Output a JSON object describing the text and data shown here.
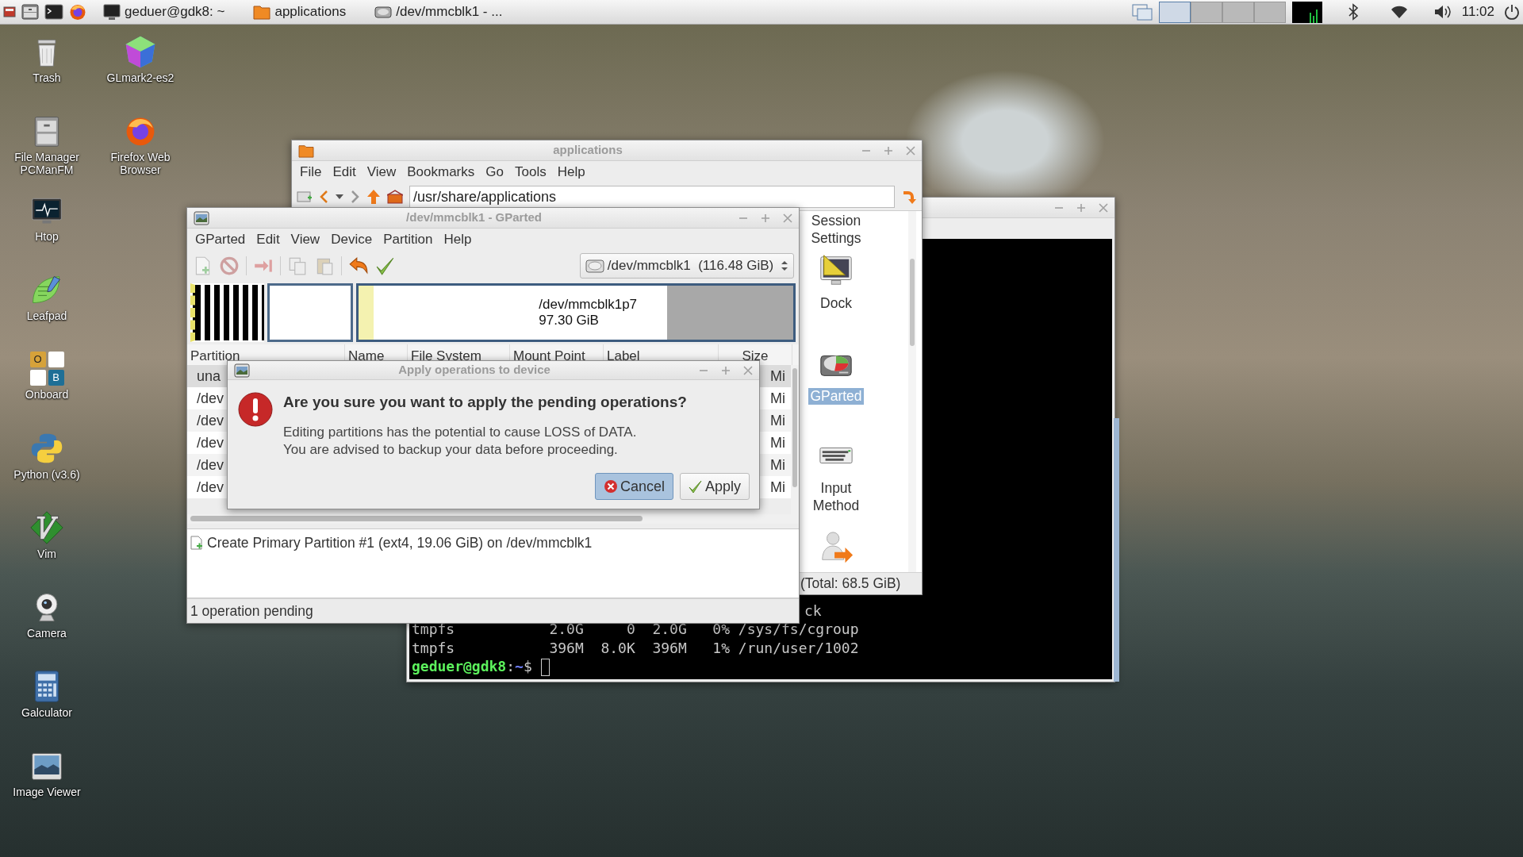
{
  "taskbar": {
    "tasks": [
      {
        "label": "geduer@gdk8: ~",
        "kind": "terminal"
      },
      {
        "label": "applications",
        "kind": "folder"
      },
      {
        "label": "/dev/mmcblk1 - ...",
        "kind": "disk"
      }
    ],
    "workspaces": [
      {
        "selected": true
      },
      {
        "selected": false
      },
      {
        "selected": false
      },
      {
        "selected": false
      }
    ],
    "clock": "11:02"
  },
  "desktop_icons": [
    {
      "label": "Trash",
      "kind": "trash"
    },
    {
      "label": "File Manager PCManFM",
      "kind": "file-manager"
    },
    {
      "label": "Htop",
      "kind": "htop"
    },
    {
      "label": "Leafpad",
      "kind": "leafpad"
    },
    {
      "label": "Onboard",
      "kind": "onboard",
      "letters": [
        "O",
        "B"
      ]
    },
    {
      "label": "Python (v3.6)",
      "kind": "python"
    },
    {
      "label": "Vim",
      "kind": "vim"
    },
    {
      "label": "Camera",
      "kind": "camera"
    },
    {
      "label": "Galculator",
      "kind": "calculator"
    },
    {
      "label": "Image Viewer",
      "kind": "image-viewer"
    },
    {
      "label": "GLmark2-es2",
      "kind": "glmark"
    },
    {
      "label": "Firefox Web Browser",
      "kind": "firefox"
    }
  ],
  "terminal": {
    "partial_line": "ck",
    "lines": [
      "tmpfs           2.0G     0  2.0G   0% /sys/fs/cgroup",
      "tmpfs           396M  8.0K  396M   1% /run/user/1002"
    ],
    "prompt": {
      "user": "geduer@gdk8",
      "separator": ":",
      "path": "~",
      "symbol": "$"
    }
  },
  "file_manager": {
    "title": "applications",
    "menu": [
      "File",
      "Edit",
      "View",
      "Bookmarks",
      "Go",
      "Tools",
      "Help"
    ],
    "path": "/usr/share/applications",
    "items": [
      {
        "label": "Session Settings",
        "kind": "session",
        "selected": false
      },
      {
        "label": "Dock",
        "kind": "dock",
        "selected": false
      },
      {
        "label": "GParted",
        "kind": "gparted",
        "selected": true
      },
      {
        "label": "Input Method",
        "kind": "keyboard",
        "selected": false
      },
      {
        "kind": "user"
      }
    ],
    "status": "(Total: 68.5 GiB)"
  },
  "gparted": {
    "title": "/dev/mmcblk1 - GParted",
    "menu": [
      "GParted",
      "Edit",
      "View",
      "Device",
      "Partition",
      "Help"
    ],
    "toolbar": [
      {
        "kind": "new",
        "disabled": true
      },
      {
        "kind": "delete",
        "disabled": true
      },
      {
        "kind": "resize",
        "disabled": true
      },
      {
        "kind": "copy",
        "disabled": true
      },
      {
        "kind": "paste",
        "disabled": true
      },
      {
        "kind": "undo",
        "disabled": false
      },
      {
        "kind": "apply",
        "disabled": false
      }
    ],
    "device": "/dev/mmcblk1",
    "device_size": "(116.48 GiB)",
    "partition_map": {
      "name": "/dev/mmcblk1p7",
      "size": "97.30 GiB",
      "level": 0.05
    },
    "columns": [
      "Partition",
      "Name",
      "File System",
      "Mount Point",
      "Label",
      "Size"
    ],
    "rows": [
      {
        "partition": "una",
        "size": "Mi",
        "selected": true
      },
      {
        "partition": "/dev",
        "size": "Mi",
        "selected": false
      },
      {
        "partition": "/dev",
        "size": "Mi",
        "selected": false
      },
      {
        "partition": "/dev",
        "size": "Mi",
        "selected": false
      },
      {
        "partition": "/dev",
        "size": "Mi",
        "selected": false
      },
      {
        "partition": "/dev",
        "size": "Mi",
        "selected": false
      }
    ],
    "operations": [
      "Create Primary Partition #1 (ext4, 19.06 GiB) on /dev/mmcblk1"
    ],
    "status": "1 operation pending"
  },
  "dialog": {
    "title": "Apply operations to device",
    "heading": "Are you sure you want to apply the pending operations?",
    "message": [
      "Editing partitions has the potential to cause LOSS of DATA.",
      "You are advised to backup your data before proceeding."
    ],
    "buttons": [
      {
        "label": "Cancel",
        "kind": "cancel",
        "focused": true
      },
      {
        "label": "Apply",
        "kind": "apply",
        "focused": false
      }
    ]
  }
}
